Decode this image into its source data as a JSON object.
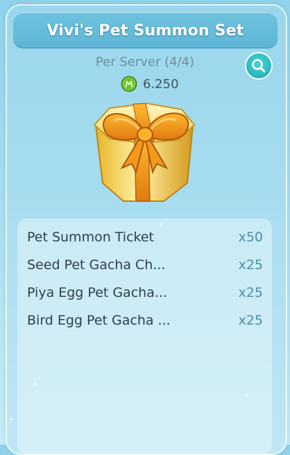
{
  "title": "Vivi's Pet Summon Set",
  "purchase_limit": "Per Server (4/4)",
  "price": {
    "currency_icon": "m-coin-icon",
    "amount": "6.250"
  },
  "search_button_icon": "magnifier-icon",
  "item_image": "golden-gift-box-with-orange-bow",
  "items": [
    {
      "name": "Pet Summon Ticket",
      "qty": "x50"
    },
    {
      "name": "Seed Pet Gacha Ch...",
      "qty": "x25"
    },
    {
      "name": "Piya Egg Pet Gacha...",
      "qty": "x25"
    },
    {
      "name": "Bird Egg Pet Gacha ...",
      "qty": "x25"
    }
  ],
  "colors": {
    "title_bar": "#5fb6d6",
    "quantity_text": "#4c8ea3",
    "search_button": "#1aa9b4",
    "coin": "#7cc43a"
  }
}
